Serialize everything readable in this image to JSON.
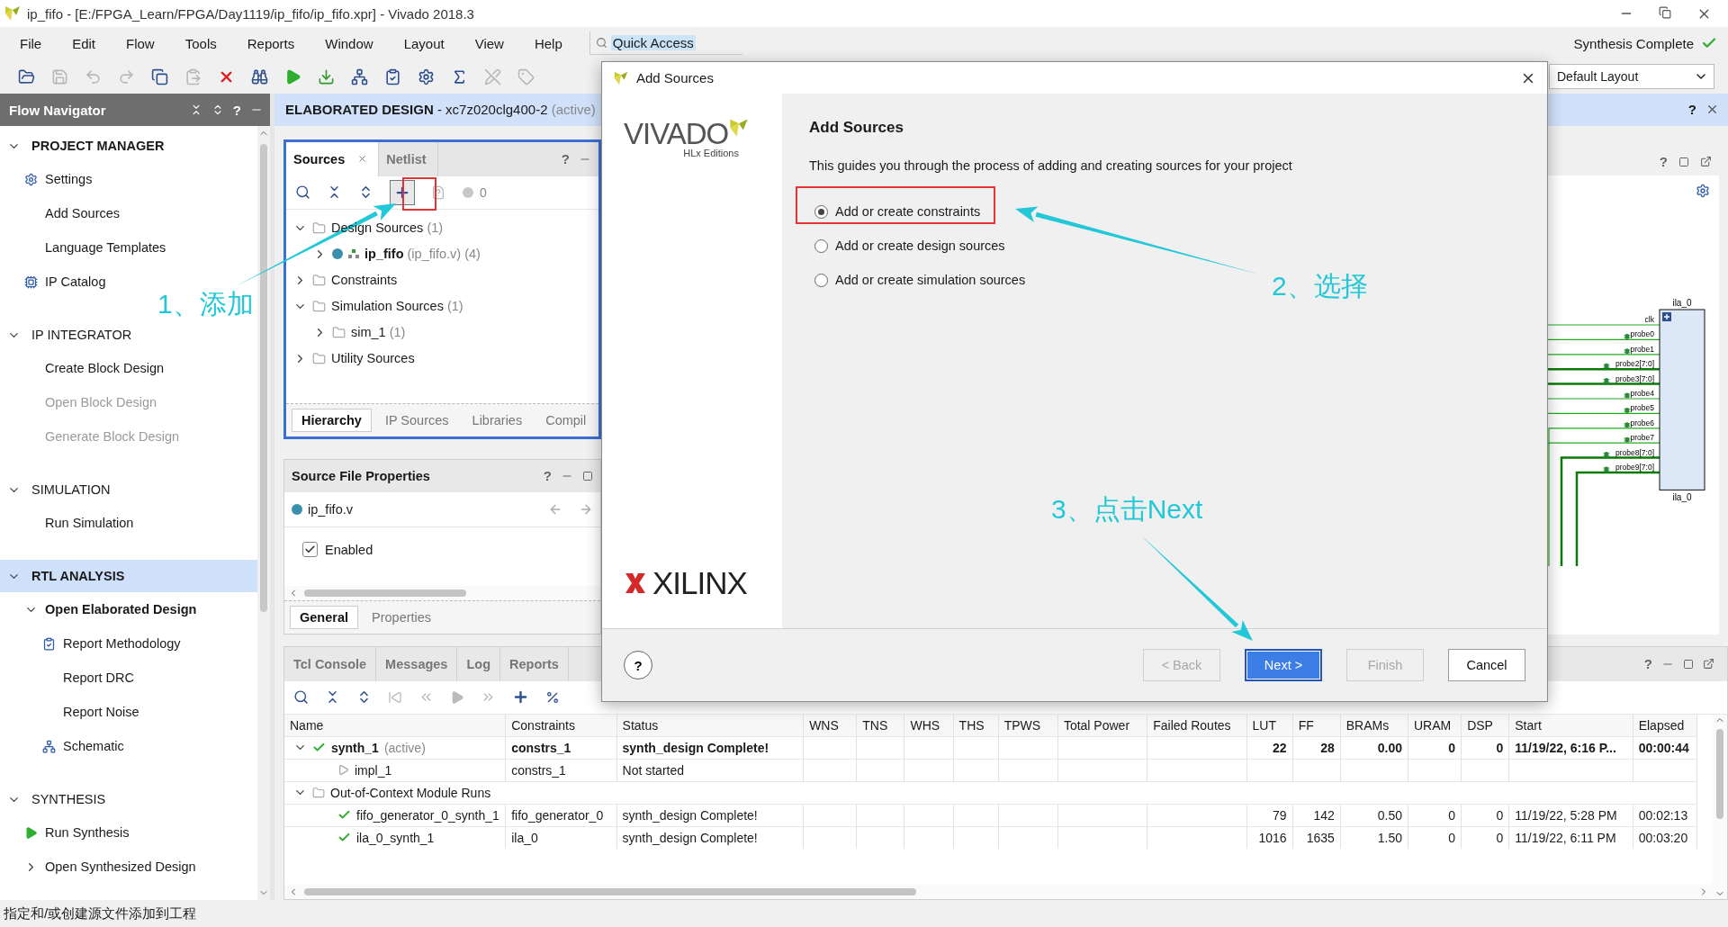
{
  "window": {
    "title": "ip_fifo - [E:/FPGA_Learn/FPGA/Day1119/ip_fifo/ip_fifo.xpr] - Vivado 2018.3"
  },
  "menu": [
    "File",
    "Edit",
    "Flow",
    "Tools",
    "Reports",
    "Window",
    "Layout",
    "View",
    "Help"
  ],
  "quick_access": {
    "value": "Quick Access"
  },
  "status_indicator": {
    "text": "Synthesis Complete",
    "complete": true
  },
  "toolbar": [
    {
      "kind": "open",
      "disabled": false
    },
    {
      "kind": "save",
      "disabled": true
    },
    {
      "kind": "undo",
      "disabled": true
    },
    {
      "kind": "redo",
      "disabled": true
    },
    {
      "kind": "copy",
      "disabled": false
    },
    {
      "kind": "paste",
      "disabled": true
    },
    {
      "kind": "delete",
      "disabled": false
    },
    {
      "kind": "find",
      "disabled": false
    },
    {
      "kind": "run",
      "disabled": false
    },
    {
      "kind": "program",
      "disabled": false
    },
    {
      "kind": "schematic",
      "disabled": false
    },
    {
      "kind": "report",
      "disabled": false
    },
    {
      "kind": "settings",
      "disabled": false
    },
    {
      "kind": "sigma",
      "disabled": false
    },
    {
      "kind": "edit",
      "disabled": true
    },
    {
      "kind": "tag",
      "disabled": true
    }
  ],
  "layout_selector": {
    "value": "Default Layout"
  },
  "flow_navigator": {
    "title": "Flow Navigator",
    "help": "?",
    "sections": [
      {
        "label": "PROJECT MANAGER",
        "open": true,
        "expanded": true,
        "selected": false,
        "items": [
          {
            "label": "Settings",
            "kind": "settings",
            "disabled": false
          },
          {
            "label": "Add Sources",
            "kind": "plain",
            "disabled": false
          },
          {
            "label": "Language Templates",
            "kind": "plain",
            "disabled": false
          },
          {
            "label": "IP Catalog",
            "kind": "catalog",
            "disabled": false
          }
        ]
      },
      {
        "label": "IP INTEGRATOR",
        "open": false,
        "expanded": true,
        "selected": false,
        "items": [
          {
            "label": "Create Block Design",
            "kind": "plain",
            "disabled": false
          },
          {
            "label": "Open Block Design",
            "kind": "plain",
            "disabled": true
          },
          {
            "label": "Generate Block Design",
            "kind": "plain",
            "disabled": true
          }
        ]
      },
      {
        "label": "SIMULATION",
        "open": false,
        "expanded": true,
        "selected": false,
        "items": [
          {
            "label": "Run Simulation",
            "kind": "plain",
            "disabled": false
          }
        ]
      },
      {
        "label": "RTL ANALYSIS",
        "open": true,
        "expanded": true,
        "selected": true,
        "items": [
          {
            "label": "Open Elaborated Design",
            "kind": "group",
            "disabled": false,
            "expanded": true,
            "open": true,
            "children": [
              {
                "label": "Report Methodology",
                "kind": "report",
                "disabled": false
              },
              {
                "label": "Report DRC",
                "kind": "plain",
                "disabled": false
              },
              {
                "label": "Report Noise",
                "kind": "plain",
                "disabled": false
              },
              {
                "label": "Schematic",
                "kind": "schematic",
                "disabled": false
              }
            ]
          }
        ]
      },
      {
        "label": "SYNTHESIS",
        "open": false,
        "expanded": true,
        "selected": false,
        "items": [
          {
            "label": "Run Synthesis",
            "kind": "run",
            "disabled": false
          },
          {
            "label": "Open Synthesized Design",
            "kind": "group",
            "disabled": false,
            "expanded": false,
            "open": false
          }
        ]
      }
    ]
  },
  "editor_header": {
    "title": "ELABORATED DESIGN",
    "part": "- xc7z020clg400-2",
    "state": "(active)",
    "help": "?"
  },
  "sources_panel": {
    "tabs": [
      {
        "label": "Sources",
        "selected": true,
        "closable": true
      },
      {
        "label": "Netlist",
        "selected": false,
        "closable": false
      }
    ],
    "help": "?",
    "message_count": "0",
    "tree": [
      {
        "label": "Design Sources",
        "count": "(1)",
        "kind": "folder",
        "expanded": true,
        "children": [
          {
            "label": "ip_fifo",
            "detail": "(ip_fifo.v) (4)",
            "kind": "module",
            "expanded": false
          }
        ]
      },
      {
        "label": "Constraints",
        "kind": "folder",
        "expanded": false
      },
      {
        "label": "Simulation Sources",
        "count": "(1)",
        "kind": "folder",
        "expanded": true,
        "children": [
          {
            "label": "sim_1",
            "count": "(1)",
            "kind": "folder",
            "expanded": false
          }
        ]
      },
      {
        "label": "Utility Sources",
        "kind": "folder",
        "expanded": false
      }
    ],
    "bottom_tabs": [
      {
        "label": "Hierarchy",
        "selected": true
      },
      {
        "label": "IP Sources",
        "selected": false
      },
      {
        "label": "Libraries",
        "selected": false
      },
      {
        "label": "Compil",
        "selected": false
      }
    ]
  },
  "properties_panel": {
    "title": "Source File Properties",
    "help": "?",
    "file": "ip_fifo.v",
    "enabled": {
      "label": "Enabled",
      "checked": true
    },
    "tabs": [
      {
        "label": "General",
        "selected": true
      },
      {
        "label": "Properties",
        "selected": false
      }
    ]
  },
  "schematic": {
    "help": "?",
    "block_top": "ila_0",
    "block_bottom": "ila_0",
    "pins": [
      {
        "name": "clk",
        "bus": false,
        "probe": false
      },
      {
        "name": "probe0",
        "bus": false,
        "probe": true
      },
      {
        "name": "probe1",
        "bus": false,
        "probe": true
      },
      {
        "name": "probe2[7:0]",
        "bus": true,
        "probe": true
      },
      {
        "name": "probe3[7:0]",
        "bus": true,
        "probe": true
      },
      {
        "name": "probe4",
        "bus": false,
        "probe": true
      },
      {
        "name": "probe5",
        "bus": false,
        "probe": true
      },
      {
        "name": "probe6",
        "bus": false,
        "probe": true
      },
      {
        "name": "probe7",
        "bus": false,
        "probe": true
      },
      {
        "name": "probe8[7:0]",
        "bus": true,
        "probe": true
      },
      {
        "name": "probe9[7:0]",
        "bus": true,
        "probe": true
      }
    ]
  },
  "bottom_panel": {
    "help": "?",
    "tabs": [
      {
        "label": "Tcl Console",
        "selected": false
      },
      {
        "label": "Messages",
        "selected": false
      },
      {
        "label": "Log",
        "selected": false
      },
      {
        "label": "Reports",
        "selected": false
      }
    ],
    "table": {
      "columns": [
        "Name",
        "Constraints",
        "Status",
        "WNS",
        "TNS",
        "WHS",
        "THS",
        "TPWS",
        "Total Power",
        "Failed Routes",
        "LUT",
        "FF",
        "BRAMs",
        "URAM",
        "DSP",
        "Start",
        "Elapsed"
      ],
      "rows": [
        {
          "kind": "complete",
          "name": "synth_1",
          "note": "(active)",
          "active": true,
          "expanded": true,
          "cells": [
            "constrs_1",
            "synth_design Complete!",
            null,
            null,
            null,
            null,
            null,
            null,
            null,
            "22",
            "28",
            "0.00",
            "0",
            "0",
            "11/19/22, 6:16 P...",
            "00:00:44"
          ],
          "children": [
            {
              "kind": "not_started",
              "name": "impl_1",
              "active": false,
              "cells": [
                "constrs_1",
                "Not started",
                null,
                null,
                null,
                null,
                null,
                null,
                null,
                null,
                null,
                null,
                null,
                null,
                null,
                null
              ]
            }
          ]
        },
        {
          "kind": "group",
          "name": "Out-of-Context Module Runs",
          "active": false,
          "expanded": true,
          "children": [
            {
              "kind": "complete",
              "name": "fifo_generator_0_synth_1",
              "active": false,
              "cells": [
                "fifo_generator_0",
                "synth_design Complete!",
                null,
                null,
                null,
                null,
                null,
                null,
                null,
                "79",
                "142",
                "0.50",
                "0",
                "0",
                "11/19/22, 5:28 PM",
                "00:02:13"
              ]
            },
            {
              "kind": "complete",
              "name": "ila_0_synth_1",
              "active": false,
              "cells": [
                "ila_0",
                "synth_design Complete!",
                null,
                null,
                null,
                null,
                null,
                null,
                null,
                "1016",
                "1635",
                "1.50",
                "0",
                "0",
                "11/19/22, 6:11 PM",
                "00:03:20"
              ]
            }
          ]
        }
      ]
    }
  },
  "dialog": {
    "title": "Add Sources",
    "product": "VIVADO",
    "edition": "HLx Editions",
    "vendor": "XILINX",
    "heading": "Add Sources",
    "description": "This guides you through the process of adding and creating sources for your project",
    "options": [
      {
        "label": "Add or create constraints",
        "selected": true
      },
      {
        "label": "Add or create design sources",
        "selected": false
      },
      {
        "label": "Add or create simulation sources",
        "selected": false
      }
    ],
    "help": "?",
    "buttons": [
      {
        "label": "< Back",
        "disabled": true,
        "primary": false
      },
      {
        "label": "Next >",
        "disabled": false,
        "primary": true
      },
      {
        "label": "Finish",
        "disabled": true,
        "primary": false
      },
      {
        "label": "Cancel",
        "disabled": false,
        "primary": false
      }
    ]
  },
  "annotations": [
    {
      "text": "1、添加"
    },
    {
      "text": "2、选择"
    },
    {
      "text": "3、点击Next"
    }
  ],
  "status_bar": {
    "text": "指定和/或创建源文件添加到工程"
  }
}
